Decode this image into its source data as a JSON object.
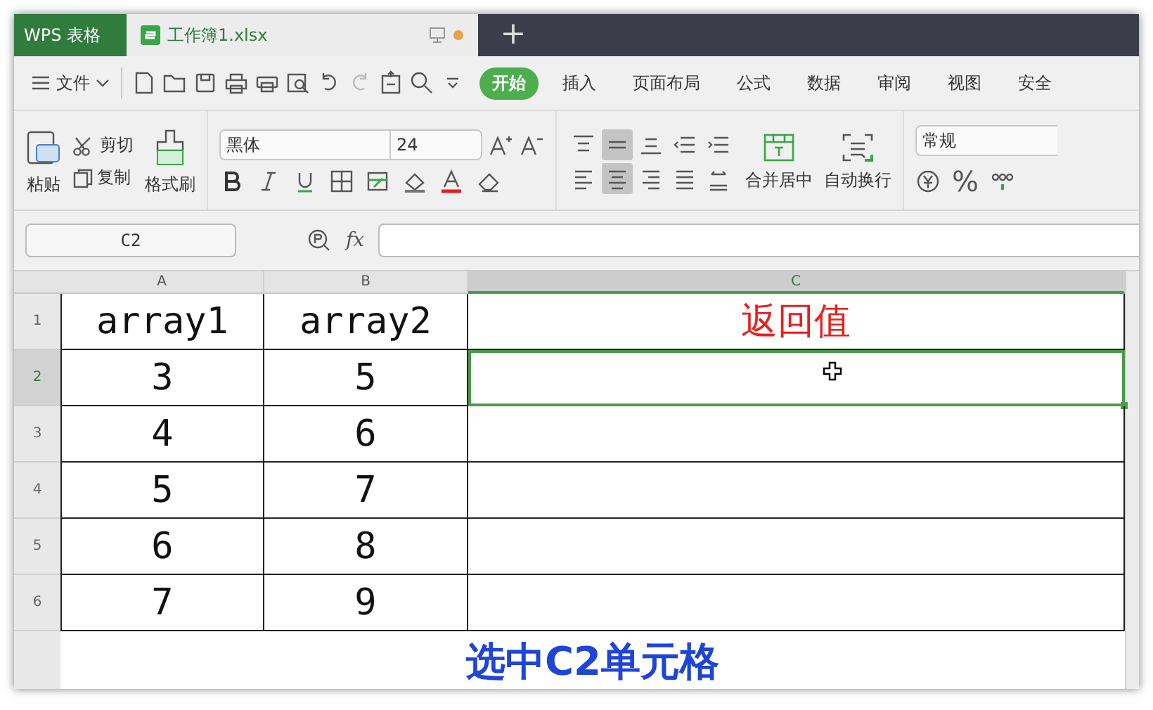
{
  "title_bar": {
    "app_tab": "WPS 表格",
    "document_tab": {
      "label": "工作簿1.xlsx",
      "selected": true
    },
    "new_tab": "+"
  },
  "menu_bar": {
    "file_menu": "文件",
    "tabs": [
      {
        "label": "开始",
        "selected": true
      },
      {
        "label": "插入",
        "selected": false
      },
      {
        "label": "页面布局",
        "selected": false
      },
      {
        "label": "公式",
        "selected": false
      },
      {
        "label": "数据",
        "selected": false
      },
      {
        "label": "审阅",
        "selected": false
      },
      {
        "label": "视图",
        "selected": false
      },
      {
        "label": "安全",
        "selected": false
      }
    ]
  },
  "ribbon": {
    "paste": "粘贴",
    "cut": "剪切",
    "copy": "复制",
    "format_painter": "格式刷",
    "font_name": "黑体",
    "font_size": "24",
    "vertical_align": [
      {
        "selected": false
      },
      {
        "selected": true
      },
      {
        "selected": false
      },
      {
        "selected": false
      },
      {
        "selected": false
      }
    ],
    "horizontal_align": [
      {
        "selected": false
      },
      {
        "selected": true
      },
      {
        "selected": false
      },
      {
        "selected": false
      },
      {
        "selected": false
      }
    ],
    "merge": "合并居中",
    "wrap": "自动换行",
    "number_format": "常规",
    "percent": "%"
  },
  "formula_bar": {
    "name_box": "C2",
    "fx": "fx"
  },
  "sheet": {
    "columns": [
      {
        "label": "A",
        "selected": false
      },
      {
        "label": "B",
        "selected": false
      },
      {
        "label": "C",
        "selected": true
      }
    ],
    "rows": [
      {
        "header": "1",
        "selected": false,
        "cells": [
          {
            "text": "array1",
            "color": "#111111",
            "selected": false
          },
          {
            "text": "array2",
            "color": "#111111",
            "selected": false
          },
          {
            "text": "返回值",
            "color": "#e8201e",
            "selected": false
          }
        ]
      },
      {
        "header": "2",
        "selected": true,
        "cells": [
          {
            "text": "3",
            "color": "#111111",
            "selected": false
          },
          {
            "text": "5",
            "color": "#111111",
            "selected": false
          },
          {
            "selected": true
          }
        ]
      },
      {
        "header": "3",
        "selected": false,
        "cells": [
          {
            "text": "4",
            "color": "#111111",
            "selected": false
          },
          {
            "text": "6",
            "color": "#111111",
            "selected": false
          },
          {
            "selected": false
          }
        ]
      },
      {
        "header": "4",
        "selected": false,
        "cells": [
          {
            "text": "5",
            "color": "#111111",
            "selected": false
          },
          {
            "text": "7",
            "color": "#111111",
            "selected": false
          },
          {
            "selected": false
          }
        ]
      },
      {
        "header": "5",
        "selected": false,
        "cells": [
          {
            "text": "6",
            "color": "#111111",
            "selected": false
          },
          {
            "text": "8",
            "color": "#111111",
            "selected": false
          },
          {
            "selected": false
          }
        ]
      },
      {
        "header": "6",
        "selected": false,
        "cells": [
          {
            "text": "7",
            "color": "#111111",
            "selected": false
          },
          {
            "text": "9",
            "color": "#111111",
            "selected": false
          },
          {
            "selected": false
          }
        ]
      }
    ],
    "caption": "选中C2单元格"
  }
}
